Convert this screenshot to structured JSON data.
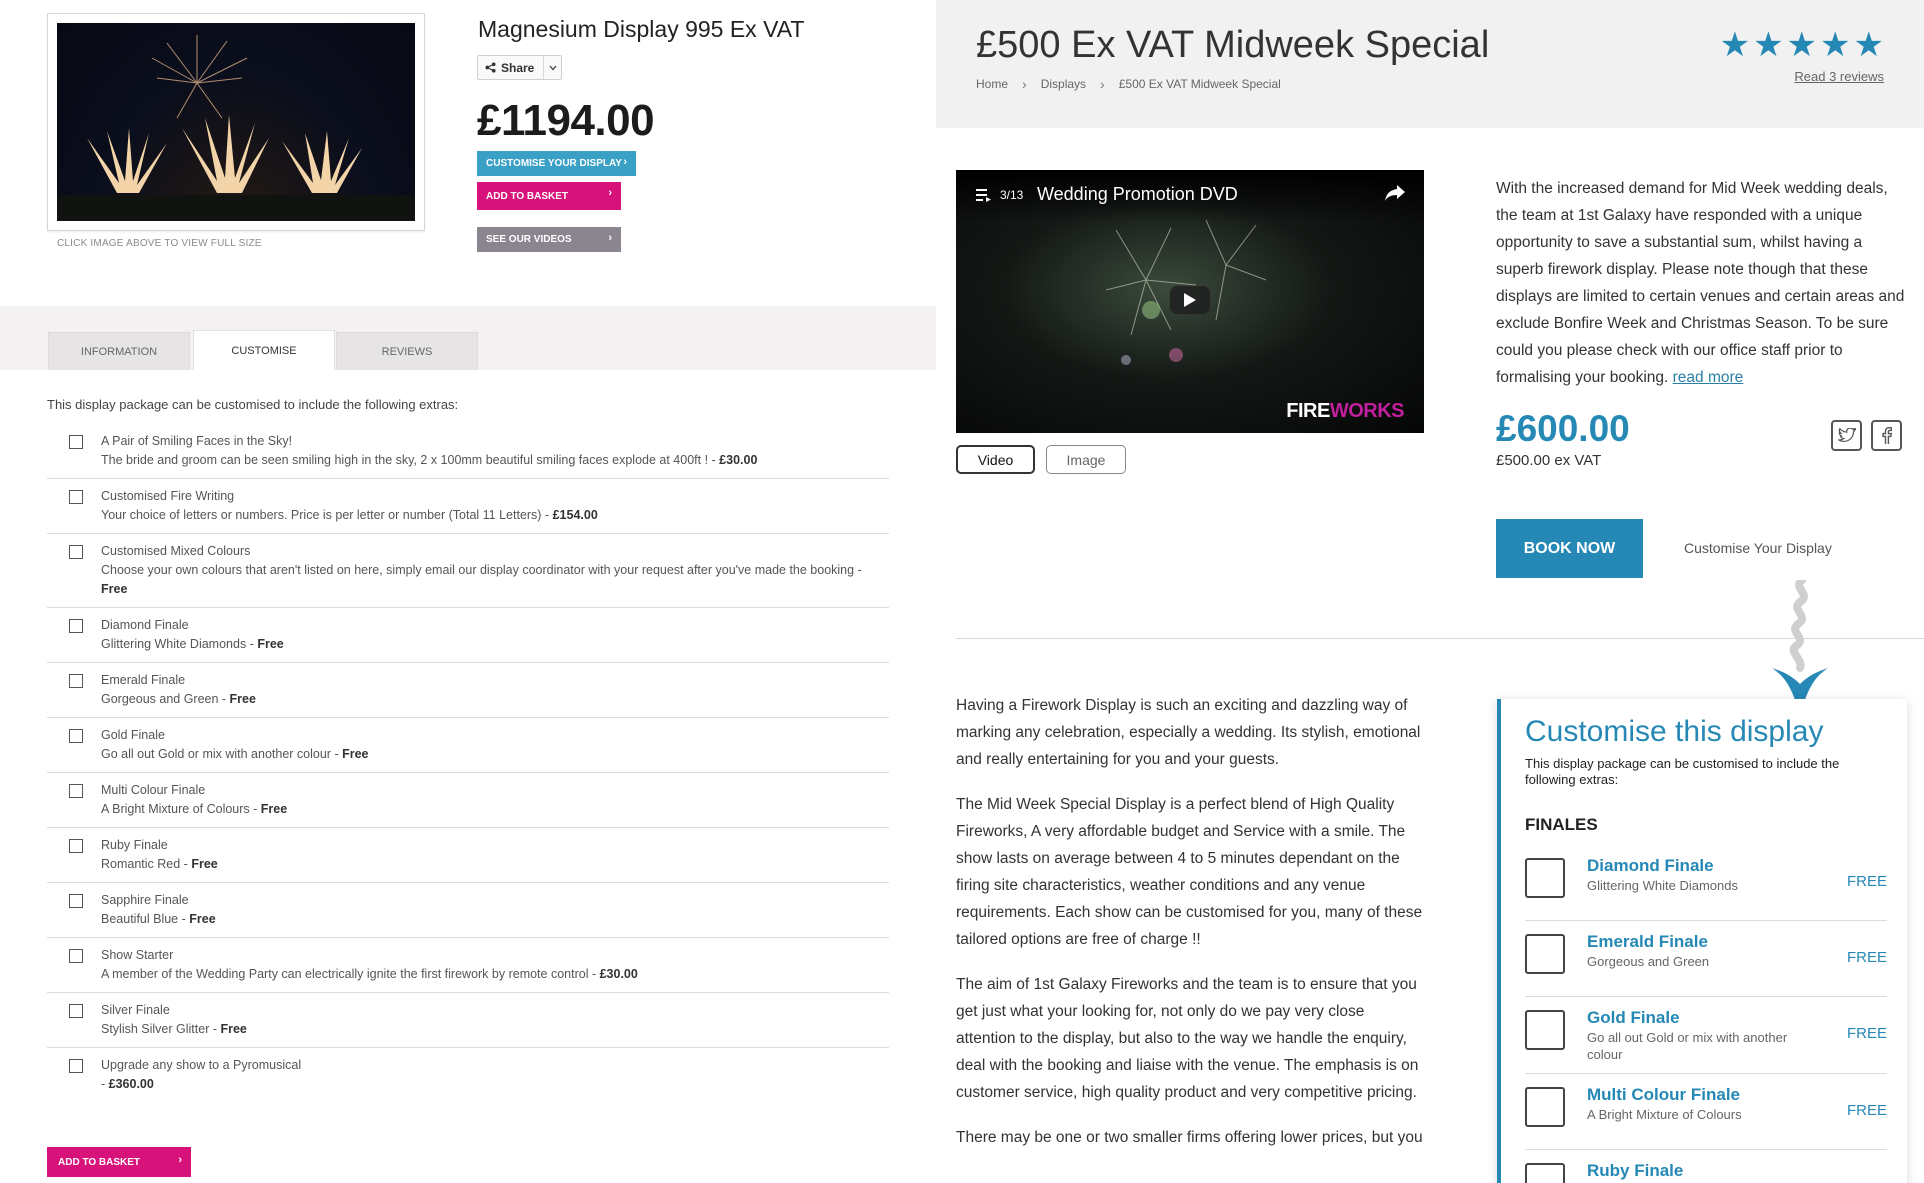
{
  "left": {
    "product_title": "Magnesium Display 995 Ex VAT",
    "share_label": "Share",
    "price": "£1194.00",
    "customise_btn": "CUSTOMISE YOUR DISPLAY",
    "basket_btn": "ADD TO BASKET",
    "videos_btn": "SEE OUR VIDEOS",
    "image_note": "CLICK IMAGE ABOVE TO VIEW FULL SIZE",
    "tabs": [
      "INFORMATION",
      "CUSTOMISE",
      "REVIEWS"
    ],
    "extras_intro": "This display package can be customised to include the following extras:",
    "extras": [
      {
        "name": "A Pair of Smiling Faces in the Sky!",
        "desc": "The bride and groom can be seen smiling high in the sky, 2 x 100mm beautiful smiling faces explode at 400ft ! - ",
        "price": "£30.00"
      },
      {
        "name": "Customised Fire Writing",
        "desc": "Your choice of letters or numbers. Price is per letter or number (Total 11 Letters) - ",
        "price": "£154.00"
      },
      {
        "name": "Customised Mixed Colours",
        "desc": "Choose your own colours that aren't listed on here, simply email our display coordinator with your request after you've made the booking - ",
        "price": "Free"
      },
      {
        "name": "Diamond Finale",
        "desc": "Glittering White Diamonds - ",
        "price": "Free"
      },
      {
        "name": "Emerald Finale",
        "desc": "Gorgeous and Green - ",
        "price": "Free"
      },
      {
        "name": "Gold Finale",
        "desc": "Go all out Gold or mix with another colour - ",
        "price": "Free"
      },
      {
        "name": "Multi Colour Finale",
        "desc": "A Bright Mixture of Colours - ",
        "price": "Free"
      },
      {
        "name": "Ruby Finale",
        "desc": "Romantic Red - ",
        "price": "Free"
      },
      {
        "name": "Sapphire Finale",
        "desc": "Beautiful Blue - ",
        "price": "Free"
      },
      {
        "name": "Show Starter",
        "desc": "A member of the Wedding Party can electrically ignite the first firework by remote control - ",
        "price": "£30.00"
      },
      {
        "name": "Silver Finale",
        "desc": "Stylish Silver Glitter - ",
        "price": "Free"
      },
      {
        "name": "Upgrade any show to a Pyromusical",
        "desc": "- ",
        "price": "£360.00"
      }
    ],
    "basket_btn_bottom": "ADD TO BASKET"
  },
  "right": {
    "title": "£500 Ex VAT Midweek Special",
    "breadcrumbs": [
      "Home",
      "Displays",
      "£500 Ex VAT Midweek Special"
    ],
    "reviews_link": "Read 3 reviews",
    "rating": 5,
    "video": {
      "counter": "3/13",
      "title": "Wedding Promotion DVD",
      "logo_a": "FIRE",
      "logo_b": "WORKS"
    },
    "media_tabs": [
      "Video",
      "Image"
    ],
    "description": "With the increased demand for Mid Week wedding deals, the team at 1st Galaxy have responded with a unique opportunity to save a substantial sum, whilst having a superb firework display. Please note though that these displays are limited to certain venues and certain areas and exclude Bonfire Week and Christmas Season. To be sure could you please check with our office staff prior to formalising your booking.",
    "read_more": "read more",
    "price": "£600.00",
    "ex_vat": "£500.00 ex VAT",
    "book_now": "BOOK NOW",
    "customise_link": "Customise Your Display",
    "body": [
      "Having a Firework Display is such an exciting and dazzling way of marking any celebration, especially a wedding. Its stylish, emotional and really entertaining for you and your guests.",
      "The Mid Week Special Display is a perfect blend of High Quality Fireworks, A very affordable budget and Service with a smile. The show lasts on average between 4 to 5 minutes dependant on the firing site characteristics, weather conditions and any venue requirements. Each show can be customised for you, many of these tailored options are free of charge !!",
      "The aim of 1st Galaxy Fireworks and the team is to ensure that you get just what your looking for, not only do we pay very close attention to the display, but also to the way we handle the enquiry, deal with the booking and liaise with the venue. The emphasis is on customer service, high quality product and very competitive pricing.",
      "There may be one or two smaller firms offering lower prices, but you"
    ],
    "customise_box": {
      "title": "Customise this display",
      "subtitle": "This display package can be customised to include the following extras:",
      "heading": "FINALES",
      "items": [
        {
          "name": "Diamond Finale",
          "desc": "Glittering White Diamonds",
          "price": "FREE"
        },
        {
          "name": "Emerald Finale",
          "desc": "Gorgeous and Green",
          "price": "FREE"
        },
        {
          "name": "Gold Finale",
          "desc": "Go all out Gold or mix with another colour",
          "price": "FREE"
        },
        {
          "name": "Multi Colour Finale",
          "desc": "A Bright Mixture of Colours",
          "price": "FREE"
        },
        {
          "name": "Ruby Finale",
          "desc": "",
          "price": ""
        }
      ]
    }
  },
  "colors": {
    "brand_blue": "#2588b5",
    "cta_blue": "#3aa0c6",
    "cta_pink": "#d8127b",
    "cta_grey": "#8b8590"
  }
}
